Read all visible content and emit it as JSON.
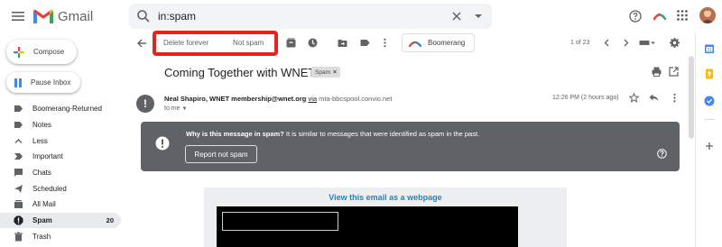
{
  "header": {
    "app_name": "Gmail",
    "search": {
      "value": "in:spam"
    }
  },
  "sidebar": {
    "compose_label": "Compose",
    "pause_inbox_label": "Pause Inbox",
    "items": [
      {
        "label": "Boomerang-Returned",
        "icon": "label-icon",
        "count": ""
      },
      {
        "label": "Notes",
        "icon": "label-icon",
        "count": ""
      },
      {
        "label": "Less",
        "icon": "chevron-up-icon",
        "count": ""
      },
      {
        "label": "Important",
        "icon": "important-icon",
        "count": ""
      },
      {
        "label": "Chats",
        "icon": "chat-icon",
        "count": ""
      },
      {
        "label": "Scheduled",
        "icon": "scheduled-icon",
        "count": ""
      },
      {
        "label": "All Mail",
        "icon": "all-mail-icon",
        "count": ""
      },
      {
        "label": "Spam",
        "icon": "spam-icon",
        "count": "20",
        "active": true
      },
      {
        "label": "Trash",
        "icon": "trash-icon",
        "count": ""
      }
    ]
  },
  "toolbar": {
    "delete_forever_label": "Delete forever",
    "not_spam_label": "Not spam",
    "boomerang_label": "Boomerang",
    "pagination": "1 of 23"
  },
  "message": {
    "subject": "Coming Together with WNET",
    "label_chip": "Spam",
    "sender_name": "Neal Shapiro, WNET membership@wnet.org",
    "via_label": "via",
    "via_domain": "mta-bbcspool.convio.net",
    "to_label": "to me",
    "time": "12:26 PM (2 hours ago)"
  },
  "spam_banner": {
    "question": "Why is this message in spam?",
    "explanation": " It is similar to messages that were identified as spam in the past.",
    "report_button_label": "Report not spam"
  },
  "email_body": {
    "webpage_link": "View this email as a webpage"
  },
  "colors": {
    "highlight_border": "#e8231c",
    "banner_bg": "#5f6368",
    "link_blue": "#1a87c6",
    "active_nav_bg": "#e8eaed"
  }
}
